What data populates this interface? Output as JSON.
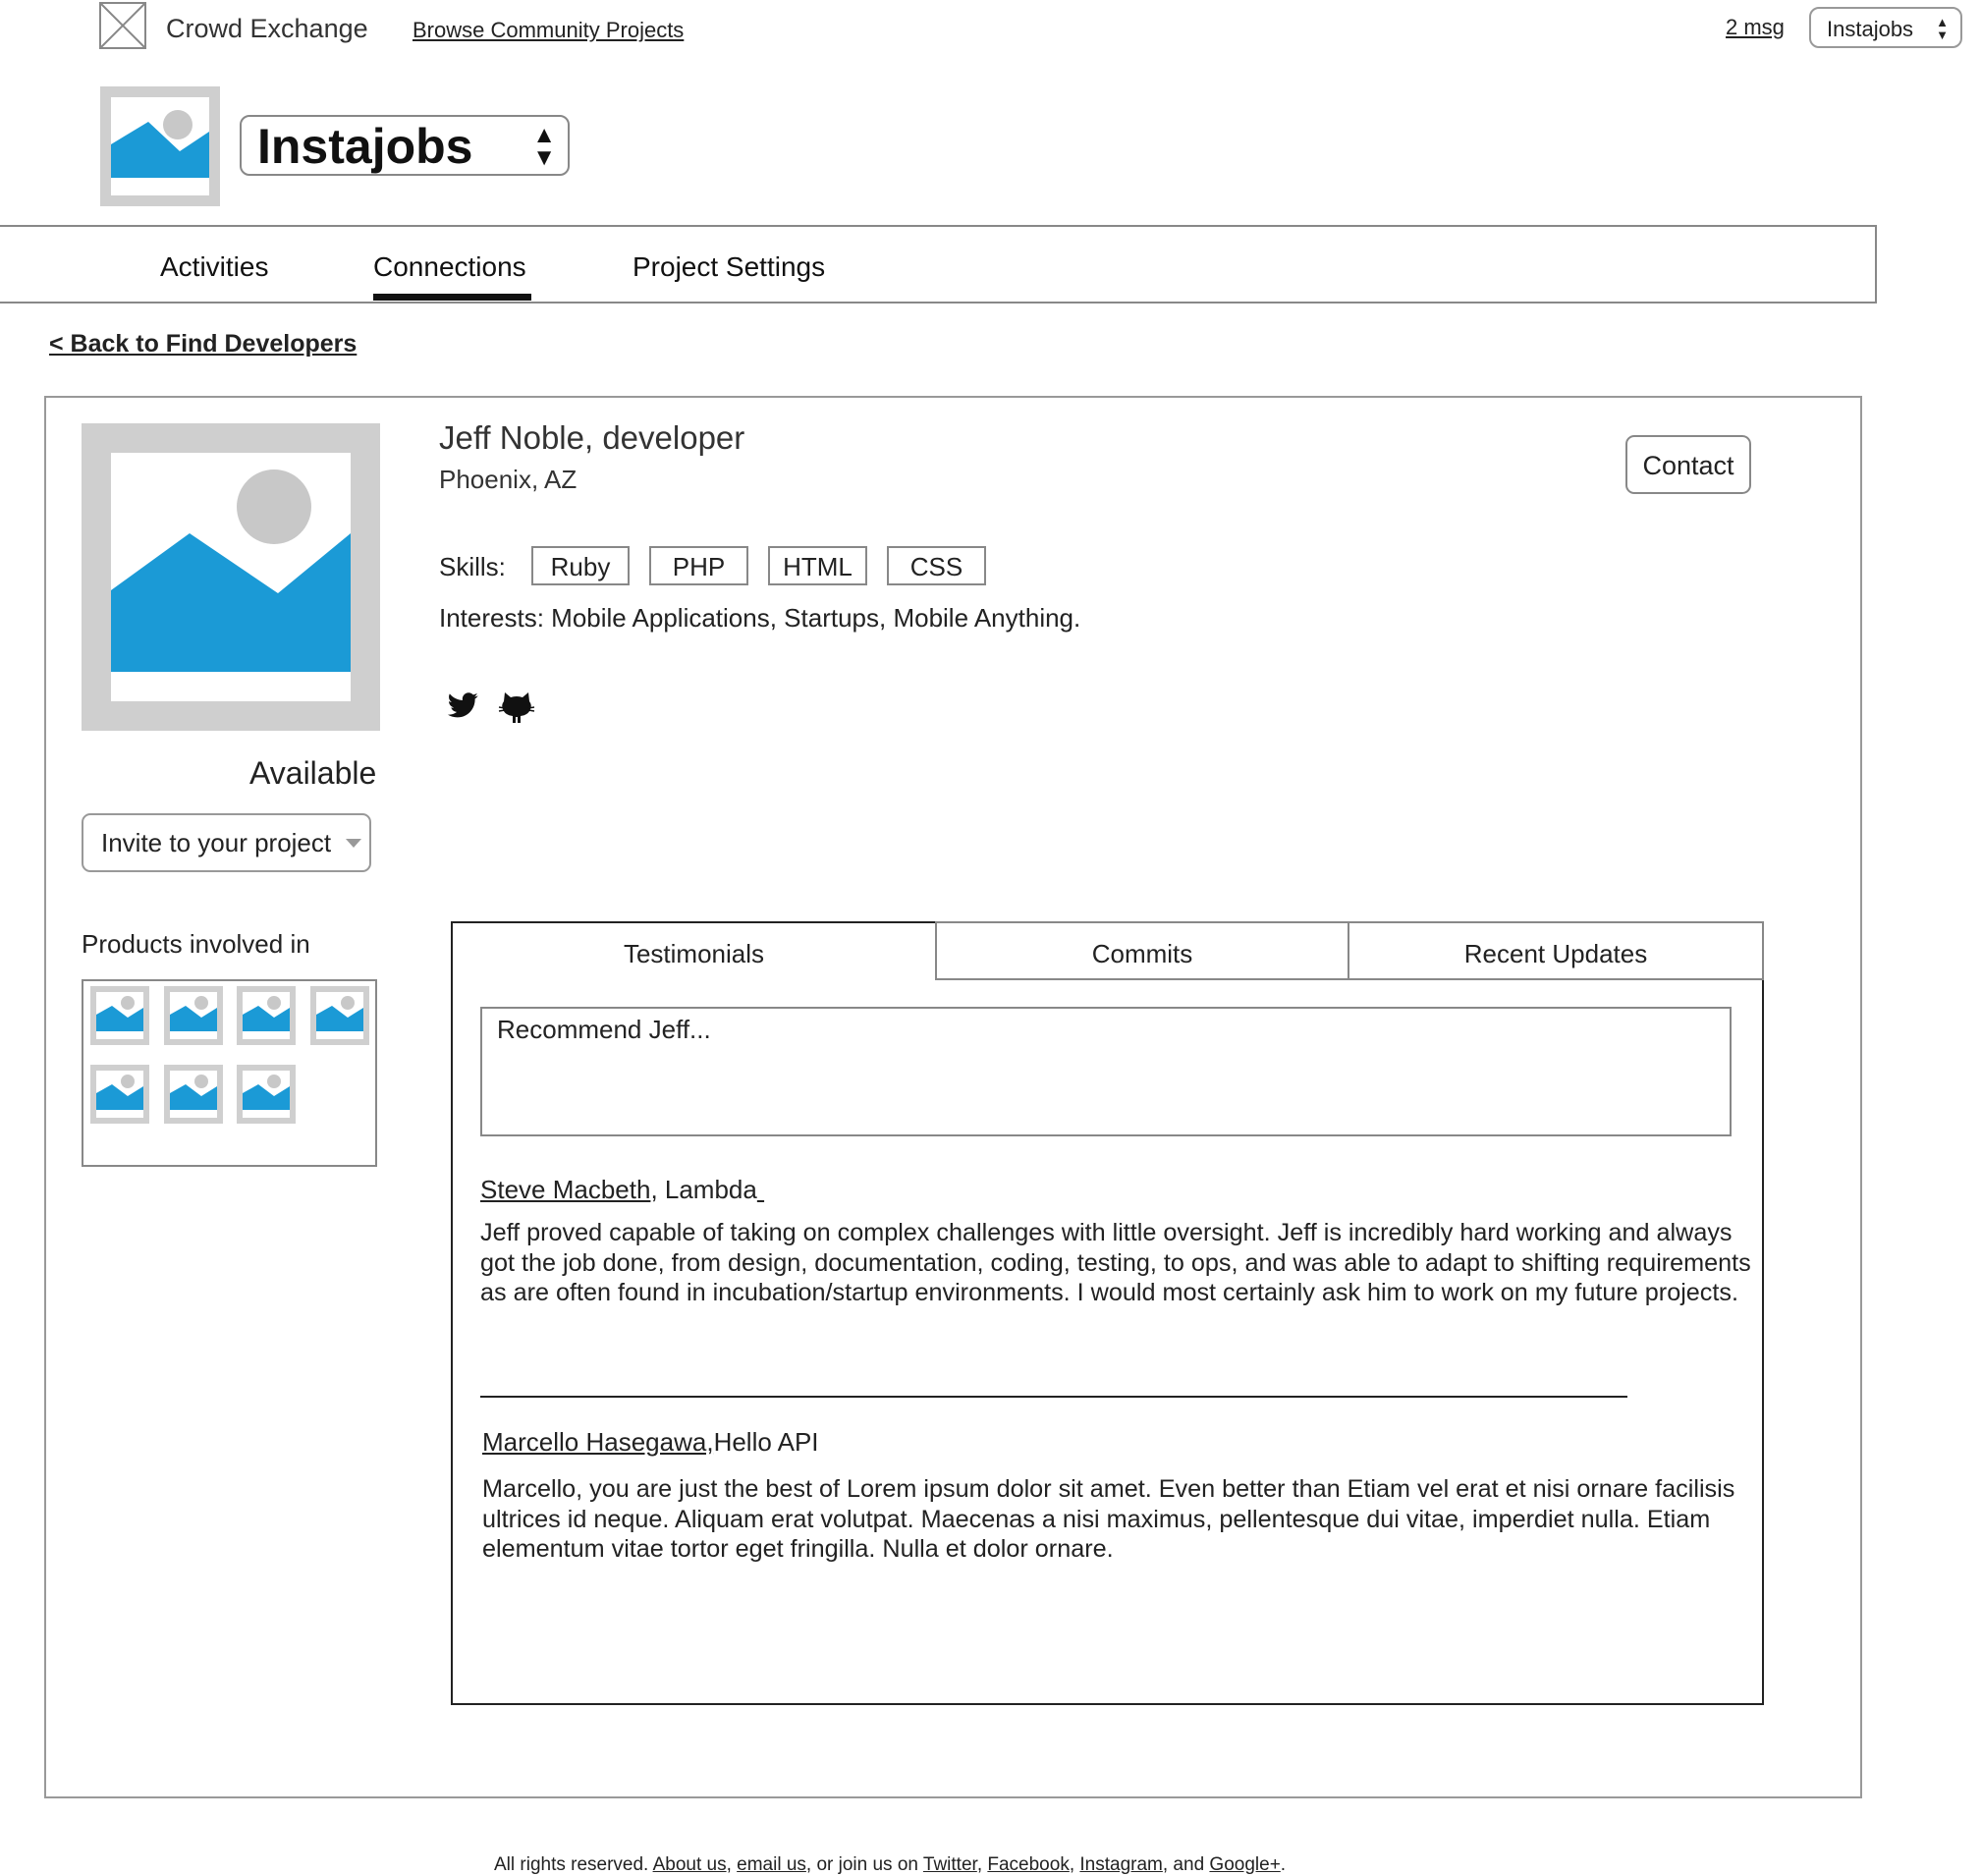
{
  "topbar": {
    "app_name": "Crowd Exchange",
    "browse_link": "Browse Community Projects",
    "messages": "2 msg",
    "project_switcher": "Instajobs"
  },
  "project": {
    "name": "Instajobs"
  },
  "nav": {
    "tabs": [
      "Activities",
      "Connections",
      "Project Settings"
    ],
    "active": "Connections"
  },
  "back_link": "< Back to Find Developers",
  "profile": {
    "name": "Jeff Noble, developer",
    "location": "Phoenix, AZ",
    "status": "Available",
    "invite_select": "Invite to your project",
    "contact_button": "Contact",
    "skills_label": "Skills:",
    "skills": [
      "Ruby",
      "PHP",
      "HTML",
      "CSS"
    ],
    "interests": "Interests: Mobile Applications, Startups, Mobile Anything.",
    "social_icons": [
      "twitter-icon",
      "github-icon"
    ]
  },
  "products": {
    "label": "Products involved in",
    "count": 7
  },
  "tabs": {
    "items": [
      "Testimonials",
      "Commits",
      "Recent Updates"
    ],
    "active": "Testimonials"
  },
  "testimonials": {
    "placeholder": "Recommend Jeff...",
    "items": [
      {
        "author": "Steve Macbeth",
        "org": ", Lambda",
        "body": "Jeff proved capable of taking on complex challenges with little oversight. Jeff is incredibly hard working and always got the job done, from design, documentation, coding, testing, to ops, and was able to adapt to shifting requirements as are often found in incubation/startup environments. I would most certainly ask him to work on my future projects."
      },
      {
        "author": "Marcello Hasegawa,",
        "org": "Hello API",
        "body": "Marcello, you are just the best of Lorem ipsum dolor sit amet. Even better than Etiam vel erat et nisi ornare facilisis ultrices id neque. Aliquam erat volutpat. Maecenas a nisi maximus, pellentesque dui vitae, imperdiet nulla. Etiam elementum vitae tortor eget fringilla. Nulla et dolor ornare."
      }
    ]
  },
  "footer": {
    "prefix": "All rights reserved. ",
    "about": "About us",
    "sep1": ", ",
    "email": "email us",
    "mid": ", or join us on ",
    "twitter": "Twitter",
    "sep2": ", ",
    "facebook": "Facebook",
    "sep3": ", ",
    "instagram": "Instagram",
    "and": ", and ",
    "google": "Google+",
    "end": "."
  },
  "colors": {
    "image_placeholder_bg": "#cfcfcf",
    "image_mountain": "#1b9ad6",
    "image_sun": "#c8c8c8"
  }
}
